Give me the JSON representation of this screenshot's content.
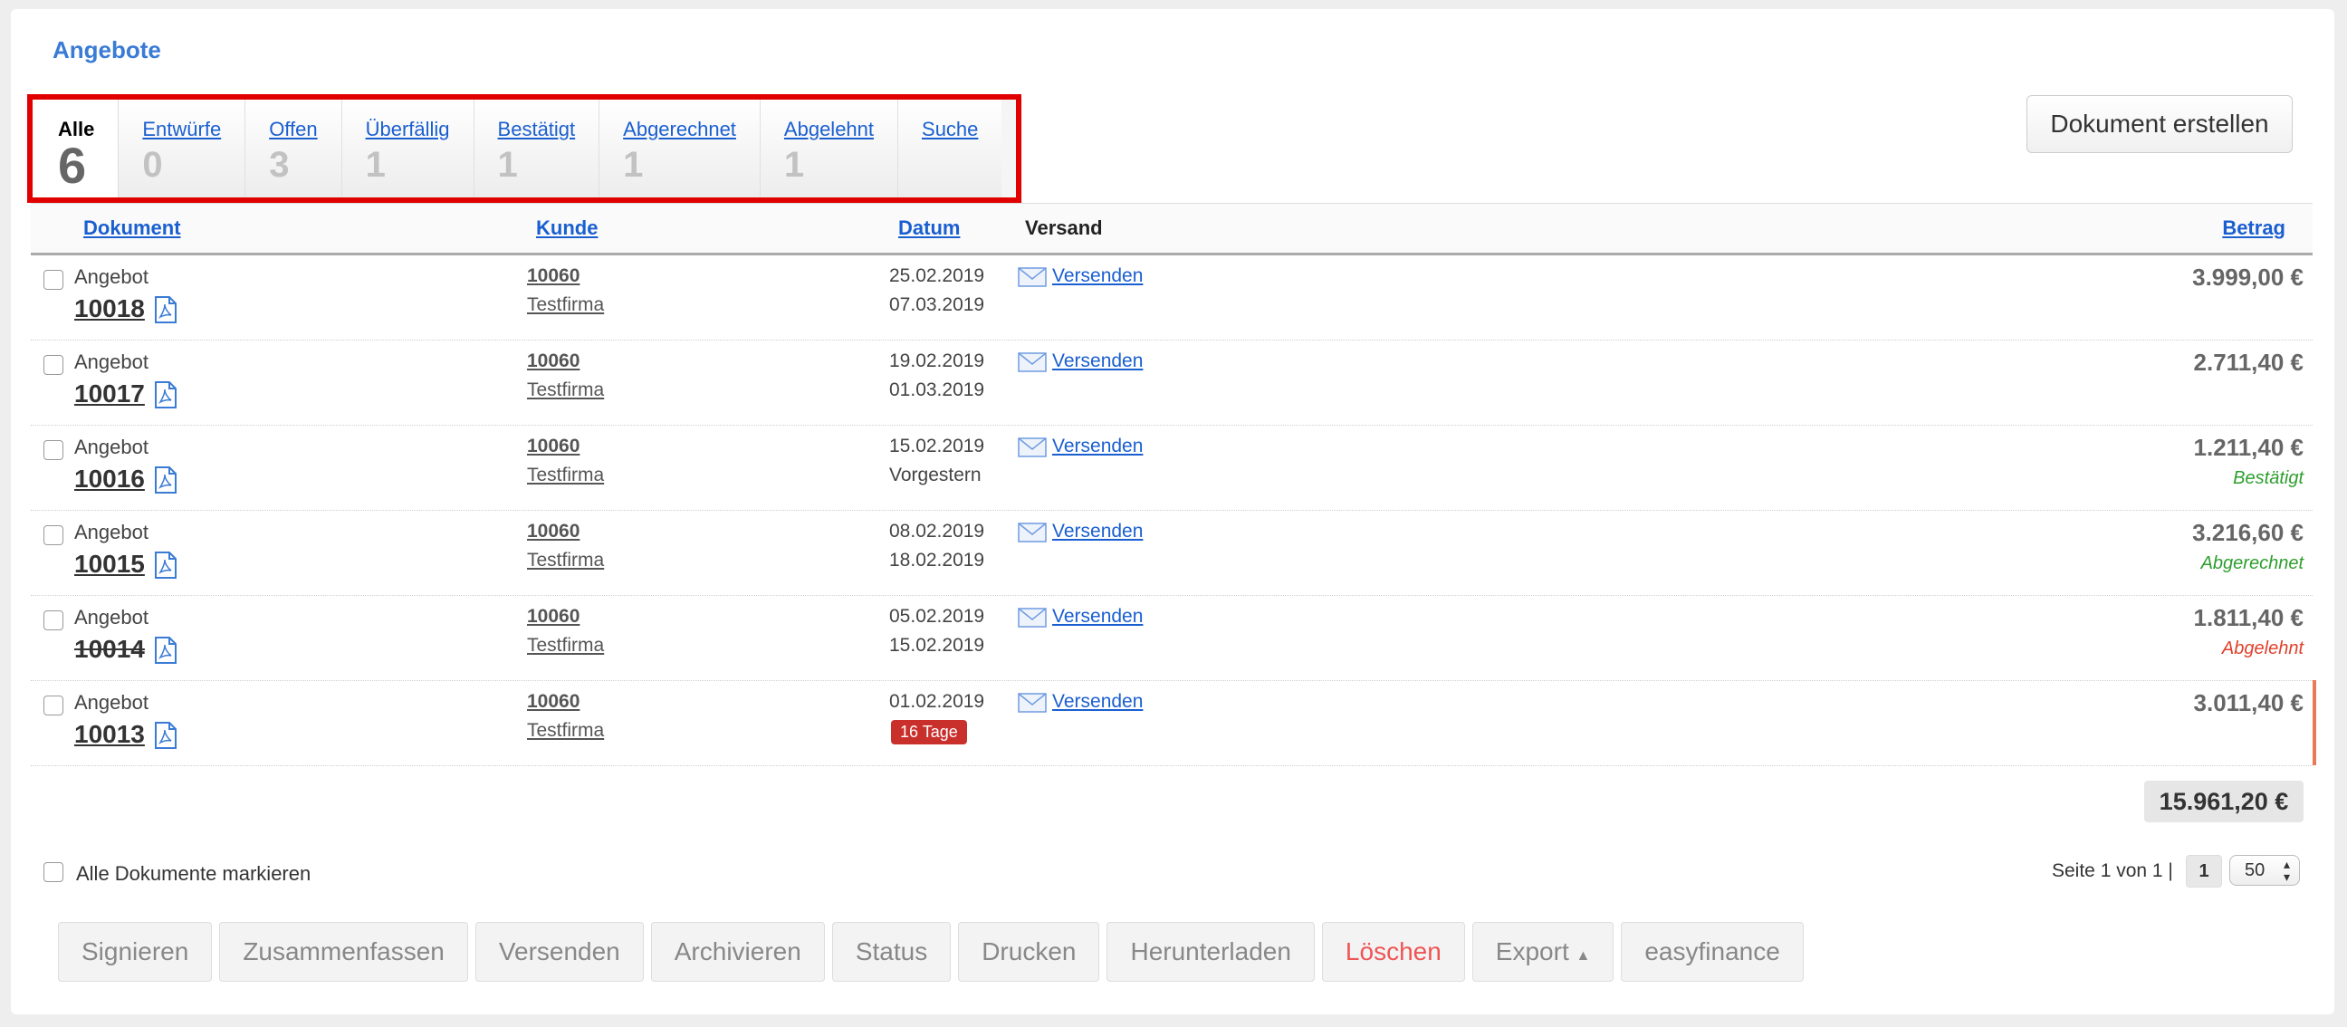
{
  "page": {
    "title": "Angebote",
    "create_button": "Dokument erstellen"
  },
  "tabs": [
    {
      "label": "Alle",
      "count": "6"
    },
    {
      "label": "Entwürfe",
      "count": "0"
    },
    {
      "label": "Offen",
      "count": "3"
    },
    {
      "label": "Überfällig",
      "count": "1"
    },
    {
      "label": "Bestätigt",
      "count": "1"
    },
    {
      "label": "Abgerechnet",
      "count": "1"
    },
    {
      "label": "Abgelehnt",
      "count": "1"
    },
    {
      "label": "Suche"
    }
  ],
  "table": {
    "headers": {
      "dokument": "Dokument",
      "kunde": "Kunde",
      "datum": "Datum",
      "versand": "Versand",
      "betrag": "Betrag"
    },
    "rows": [
      {
        "type": "Angebot",
        "number": "10018",
        "customer_no": "10060",
        "customer": "Testfirma",
        "date1": "25.02.2019",
        "date2": "07.03.2019",
        "send": "Versenden",
        "amount": "3.999,00 €",
        "status": ""
      },
      {
        "type": "Angebot",
        "number": "10017",
        "customer_no": "10060",
        "customer": "Testfirma",
        "date1": "19.02.2019",
        "date2": "01.03.2019",
        "send": "Versenden",
        "amount": "2.711,40 €",
        "status": ""
      },
      {
        "type": "Angebot",
        "number": "10016",
        "customer_no": "10060",
        "customer": "Testfirma",
        "date1": "15.02.2019",
        "date2": "Vorgestern",
        "send": "Versenden",
        "amount": "1.211,40 €",
        "status": "Bestätigt",
        "status_color": "#2e9e2e"
      },
      {
        "type": "Angebot",
        "number": "10015",
        "customer_no": "10060",
        "customer": "Testfirma",
        "date1": "08.02.2019",
        "date2": "18.02.2019",
        "send": "Versenden",
        "amount": "3.216,60 €",
        "status": "Abgerechnet",
        "status_color": "#2e9e2e"
      },
      {
        "type": "Angebot",
        "number": "10014",
        "customer_no": "10060",
        "customer": "Testfirma",
        "date1": "05.02.2019",
        "date2": "15.02.2019",
        "send": "Versenden",
        "amount": "1.811,40 €",
        "status": "Abgelehnt",
        "status_color": "#e0412c"
      },
      {
        "type": "Angebot",
        "number": "10013",
        "customer_no": "10060",
        "customer": "Testfirma",
        "date1": "01.02.2019",
        "badge": "16 Tage",
        "send": "Versenden",
        "amount": "3.011,40 €",
        "status": ""
      }
    ],
    "total": "15.961,20 €"
  },
  "footer": {
    "select_all": "Alle Dokumente markieren",
    "pager_text": "Seite 1 von 1 |",
    "pager_page": "1",
    "per_page": "50"
  },
  "actions": [
    "Signieren",
    "Zusammenfassen",
    "Versenden",
    "Archivieren",
    "Status",
    "Drucken",
    "Herunterladen",
    "Löschen",
    "Export",
    "easyfinance"
  ],
  "colors": {
    "link": "#1a5fd0",
    "highlight": "#e00000",
    "danger": "#e55555",
    "overdue_badge": "#c9302c"
  }
}
